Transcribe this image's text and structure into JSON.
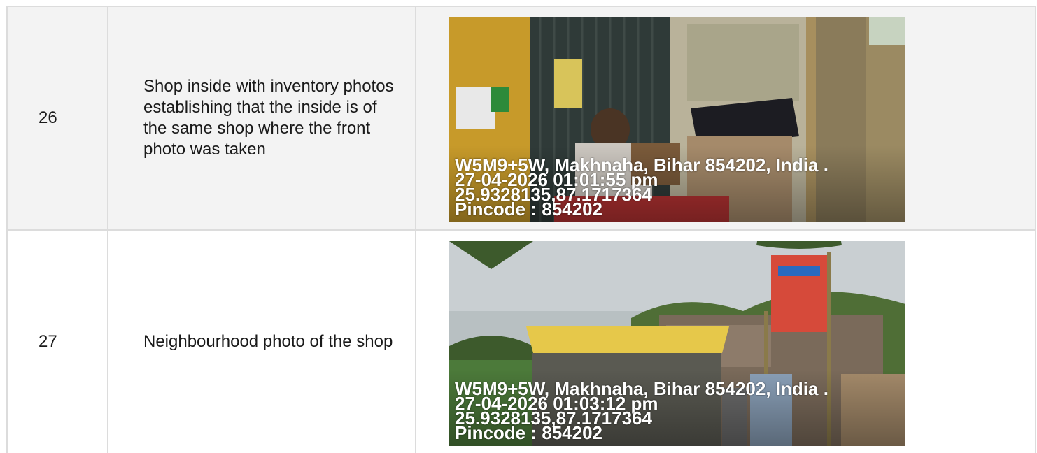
{
  "rows": [
    {
      "number": "26",
      "description": "Shop inside with inventory photos establishing that the inside is of the same shop where the front photo was taken",
      "stamp": {
        "address": "W5M9+5W, Makhnaha, Bihar 854202, India .",
        "datetime": "27-04-2026 01:01:55 pm",
        "coordinates": "25.9328135,87.1717364",
        "pincode": "Pincode : 854202"
      }
    },
    {
      "number": "27",
      "description": "Neighbourhood photo of the shop",
      "stamp": {
        "address": "W5M9+5W, Makhnaha, Bihar 854202, India .",
        "datetime": "27-04-2026 01:03:12 pm",
        "coordinates": "25.9328135,87.1717364",
        "pincode": "Pincode : 854202"
      }
    }
  ]
}
